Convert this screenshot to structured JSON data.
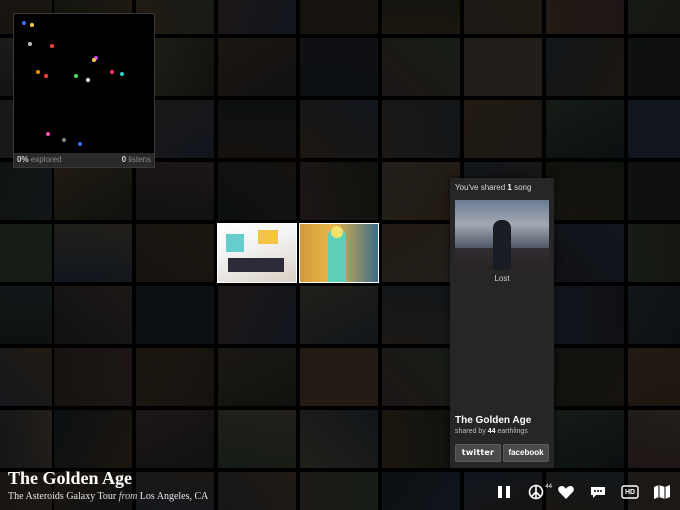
{
  "minimap": {
    "explored_percent": "0%",
    "explored_label": "explored",
    "listens_count": "0",
    "listens_label": "listens",
    "dot_colors": [
      "#3c6bff",
      "#ffcc33",
      "#ff4040",
      "#bbbbbb",
      "#ff8800",
      "#cc44ff",
      "#44dd66",
      "#ffffff",
      "#ff3366",
      "#33cccc",
      "#ff55aa",
      "#888888"
    ]
  },
  "share_panel": {
    "prefix": "You've shared",
    "count": "1",
    "suffix": "song",
    "photo_caption": "Lost",
    "song_title": "The Golden Age",
    "shared_by_prefix": "shared by",
    "shared_by_count": "44",
    "shared_by_suffix": "earthlings",
    "twitter_label": "twitter",
    "facebook_label": "facebook"
  },
  "now_playing": {
    "title": "The Golden Age",
    "artist": "The Asteroids Galaxy Tour",
    "from_word": "from",
    "location": "Los Angeles, CA"
  },
  "toolbar": {
    "pause_icon": "pause-icon",
    "peace_icon": "peace-icon",
    "peace_count": "44",
    "heart_icon": "heart-icon",
    "comment_icon": "comment-icon",
    "hd_label": "HD",
    "map_icon": "map-icon"
  }
}
